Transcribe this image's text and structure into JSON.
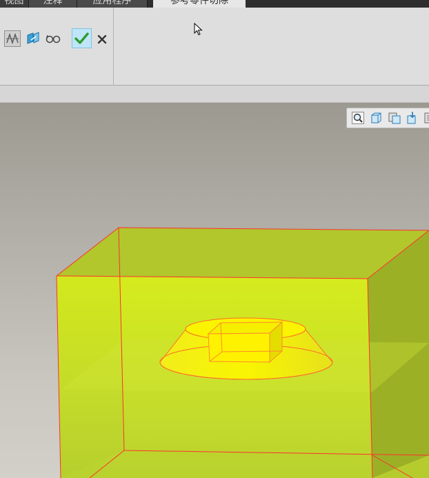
{
  "tabs": [
    {
      "label": "视图",
      "active": false
    },
    {
      "label": "注释",
      "active": false
    },
    {
      "label": "应用程序",
      "active": false
    },
    {
      "label": "参考零件切除",
      "active": true
    }
  ],
  "ribbon": {
    "buttons": [
      {
        "icon": "reference-geometry-icon"
      },
      {
        "icon": "dimension-flag-icon"
      },
      {
        "icon": "glasses-preview-icon"
      },
      {
        "icon": "checkmark-icon",
        "state": "highlighted"
      },
      {
        "icon": "close-icon"
      }
    ]
  },
  "view_toolbar": {
    "buttons": [
      "zoom-fit-icon",
      "saved-orientation-icon",
      "view-manager-icon",
      "spin-center-icon",
      "more-icon"
    ]
  },
  "model": {
    "body_color": "#c4dc2a",
    "inner_feature_color": "#f2ef00",
    "edge_color": "#ff2f2f"
  },
  "colors": {
    "tabbar_bg": "#2e2e2e",
    "active_tab_bg": "#e7e7e7",
    "ribbon_bg": "#dedede",
    "confirm_bg": "#bfe6f7"
  }
}
